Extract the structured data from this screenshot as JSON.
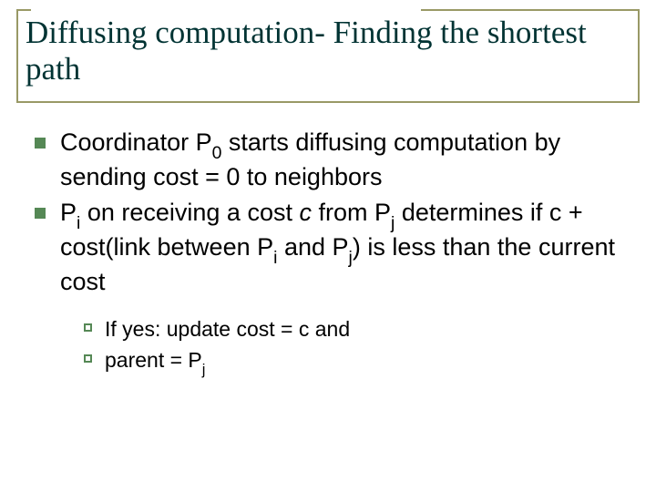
{
  "title": "Diffusing computation- Finding the shortest path",
  "bullets": [
    {
      "pre": "Coordinator P",
      "sub0": "0",
      "post": " starts diffusing computation by sending cost  = 0 to neighbors"
    },
    {
      "p1": "P",
      "s1": "i",
      "p2": " on receiving a cost ",
      "c_ital": "c",
      "p3": " from P",
      "s2": "j",
      "p4": " determines if c + cost(link between P",
      "s3": "i",
      "p5": " and P",
      "s4": "j",
      "p6": ") is less than the current cost"
    }
  ],
  "sub_bullets": [
    {
      "text": "If yes: update cost = c and"
    },
    {
      "pre": "parent = P",
      "sub": "j"
    }
  ]
}
